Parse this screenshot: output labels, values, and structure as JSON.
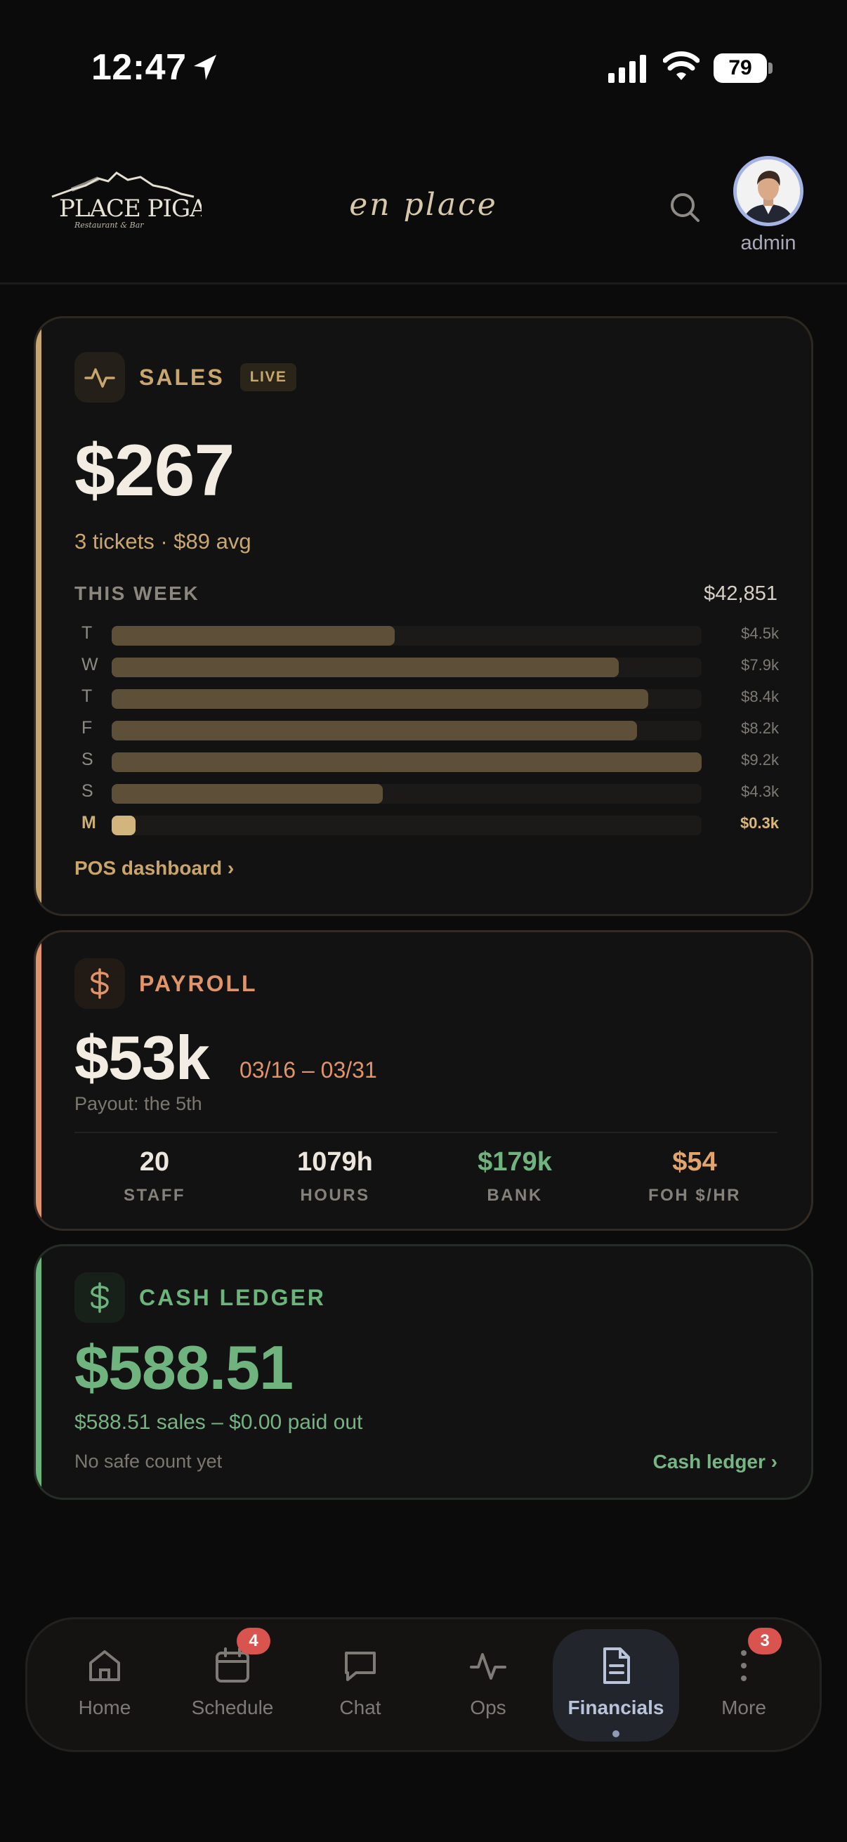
{
  "status_bar": {
    "time": "12:47",
    "battery": "79"
  },
  "header": {
    "brand_logo": "PLACE PIGALLE",
    "brand_tagline": "Restaurant & Bar",
    "title": "en place",
    "user_label": "admin"
  },
  "sales": {
    "label": "SALES",
    "badge": "LIVE",
    "amount": "$267",
    "summary": "3 tickets · $89 avg",
    "week_label": "THIS WEEK",
    "week_total": "$42,851",
    "days": [
      {
        "day": "T",
        "value": "$4.5k",
        "amount": 4.5,
        "fraction": 0.48,
        "today": false
      },
      {
        "day": "W",
        "value": "$7.9k",
        "amount": 7.9,
        "fraction": 0.86,
        "today": false
      },
      {
        "day": "T",
        "value": "$8.4k",
        "amount": 8.4,
        "fraction": 0.91,
        "today": false
      },
      {
        "day": "F",
        "value": "$8.2k",
        "amount": 8.2,
        "fraction": 0.89,
        "today": false
      },
      {
        "day": "S",
        "value": "$9.2k",
        "amount": 9.2,
        "fraction": 1.0,
        "today": false
      },
      {
        "day": "S",
        "value": "$4.3k",
        "amount": 4.3,
        "fraction": 0.46,
        "today": false
      },
      {
        "day": "M",
        "value": "$0.3k",
        "amount": 0.3,
        "fraction": 0.04,
        "today": true
      }
    ],
    "link": "POS dashboard ›"
  },
  "payroll": {
    "label": "PAYROLL",
    "amount": "$53k",
    "dates": "03/16 – 03/31",
    "payout": "Payout: the 5th",
    "stats": [
      {
        "value": "20",
        "label": "STAFF",
        "color": "#ece6dc"
      },
      {
        "value": "1079h",
        "label": "HOURS",
        "color": "#ece6dc"
      },
      {
        "value": "$179k",
        "label": "BANK",
        "color": "#6fb47f"
      },
      {
        "value": "$54",
        "label": "FOH $/HR",
        "color": "#e0a46c"
      }
    ]
  },
  "cash": {
    "label": "CASH LEDGER",
    "amount": "$588.51",
    "breakdown": "$588.51 sales – $0.00 paid out",
    "note": "No safe count yet",
    "link": "Cash ledger ›"
  },
  "tabs": [
    {
      "label": "Home",
      "icon": "home-icon",
      "badge": ""
    },
    {
      "label": "Schedule",
      "icon": "calendar-icon",
      "badge": "4"
    },
    {
      "label": "Chat",
      "icon": "chat-icon",
      "badge": ""
    },
    {
      "label": "Ops",
      "icon": "activity-icon",
      "badge": ""
    },
    {
      "label": "Financials",
      "icon": "document-icon",
      "badge": "",
      "active": true
    },
    {
      "label": "More",
      "icon": "more-icon",
      "badge": "3"
    }
  ],
  "colors": {
    "gold": "#c9a66e",
    "orange": "#e0946a",
    "green": "#6bb57c",
    "badge_red": "#d9534f"
  }
}
